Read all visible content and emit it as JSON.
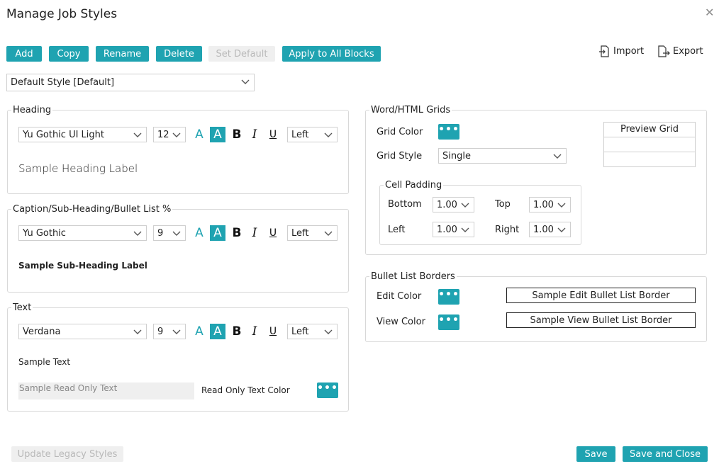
{
  "dialog": {
    "title": "Manage Job Styles",
    "close_glyph": "✕"
  },
  "toolbar": {
    "add": "Add",
    "copy": "Copy",
    "rename": "Rename",
    "delete": "Delete",
    "set_default": "Set Default",
    "apply_all": "Apply to All Blocks",
    "import": "Import",
    "export": "Export"
  },
  "style_select": {
    "value": "Default Style [Default]"
  },
  "heading": {
    "legend": "Heading",
    "font": "Yu Gothic UI Light",
    "size": "12",
    "align": "Left",
    "sample": "Sample Heading Label"
  },
  "caption": {
    "legend": "Caption/Sub-Heading/Bullet List %",
    "font": "Yu Gothic",
    "size": "9",
    "align": "Left",
    "sample": "Sample Sub-Heading Label"
  },
  "text": {
    "legend": "Text",
    "font": "Verdana",
    "size": "9",
    "align": "Left",
    "sample": "Sample Text",
    "readonly_sample": "Sample Read Only Text",
    "readonly_color_label": "Read Only Text Color"
  },
  "format_glyphs": {
    "a": "A",
    "b": "B",
    "i": "I",
    "u": "U",
    "dots": "•••"
  },
  "grids": {
    "legend": "Word/HTML Grids",
    "grid_color_label": "Grid Color",
    "grid_style_label": "Grid Style",
    "grid_style_value": "Single",
    "preview_label": "Preview Grid",
    "padding": {
      "legend": "Cell Padding",
      "bottom_label": "Bottom",
      "bottom_value": "1.00",
      "top_label": "Top",
      "top_value": "1.00",
      "left_label": "Left",
      "left_value": "1.00",
      "right_label": "Right",
      "right_value": "1.00"
    }
  },
  "bullets": {
    "legend": "Bullet List Borders",
    "edit_label": "Edit Color",
    "edit_sample": "Sample Edit Bullet List Border",
    "view_label": "View Color",
    "view_sample": "Sample View Bullet List Border"
  },
  "footer": {
    "legacy": "Update Legacy Styles",
    "save": "Save",
    "save_close": "Save and Close"
  },
  "colors": {
    "accent": "#1fa3b1",
    "disabled_bg": "#efefef",
    "disabled_text": "#b9b9b9",
    "border": "#d8d8d8"
  }
}
